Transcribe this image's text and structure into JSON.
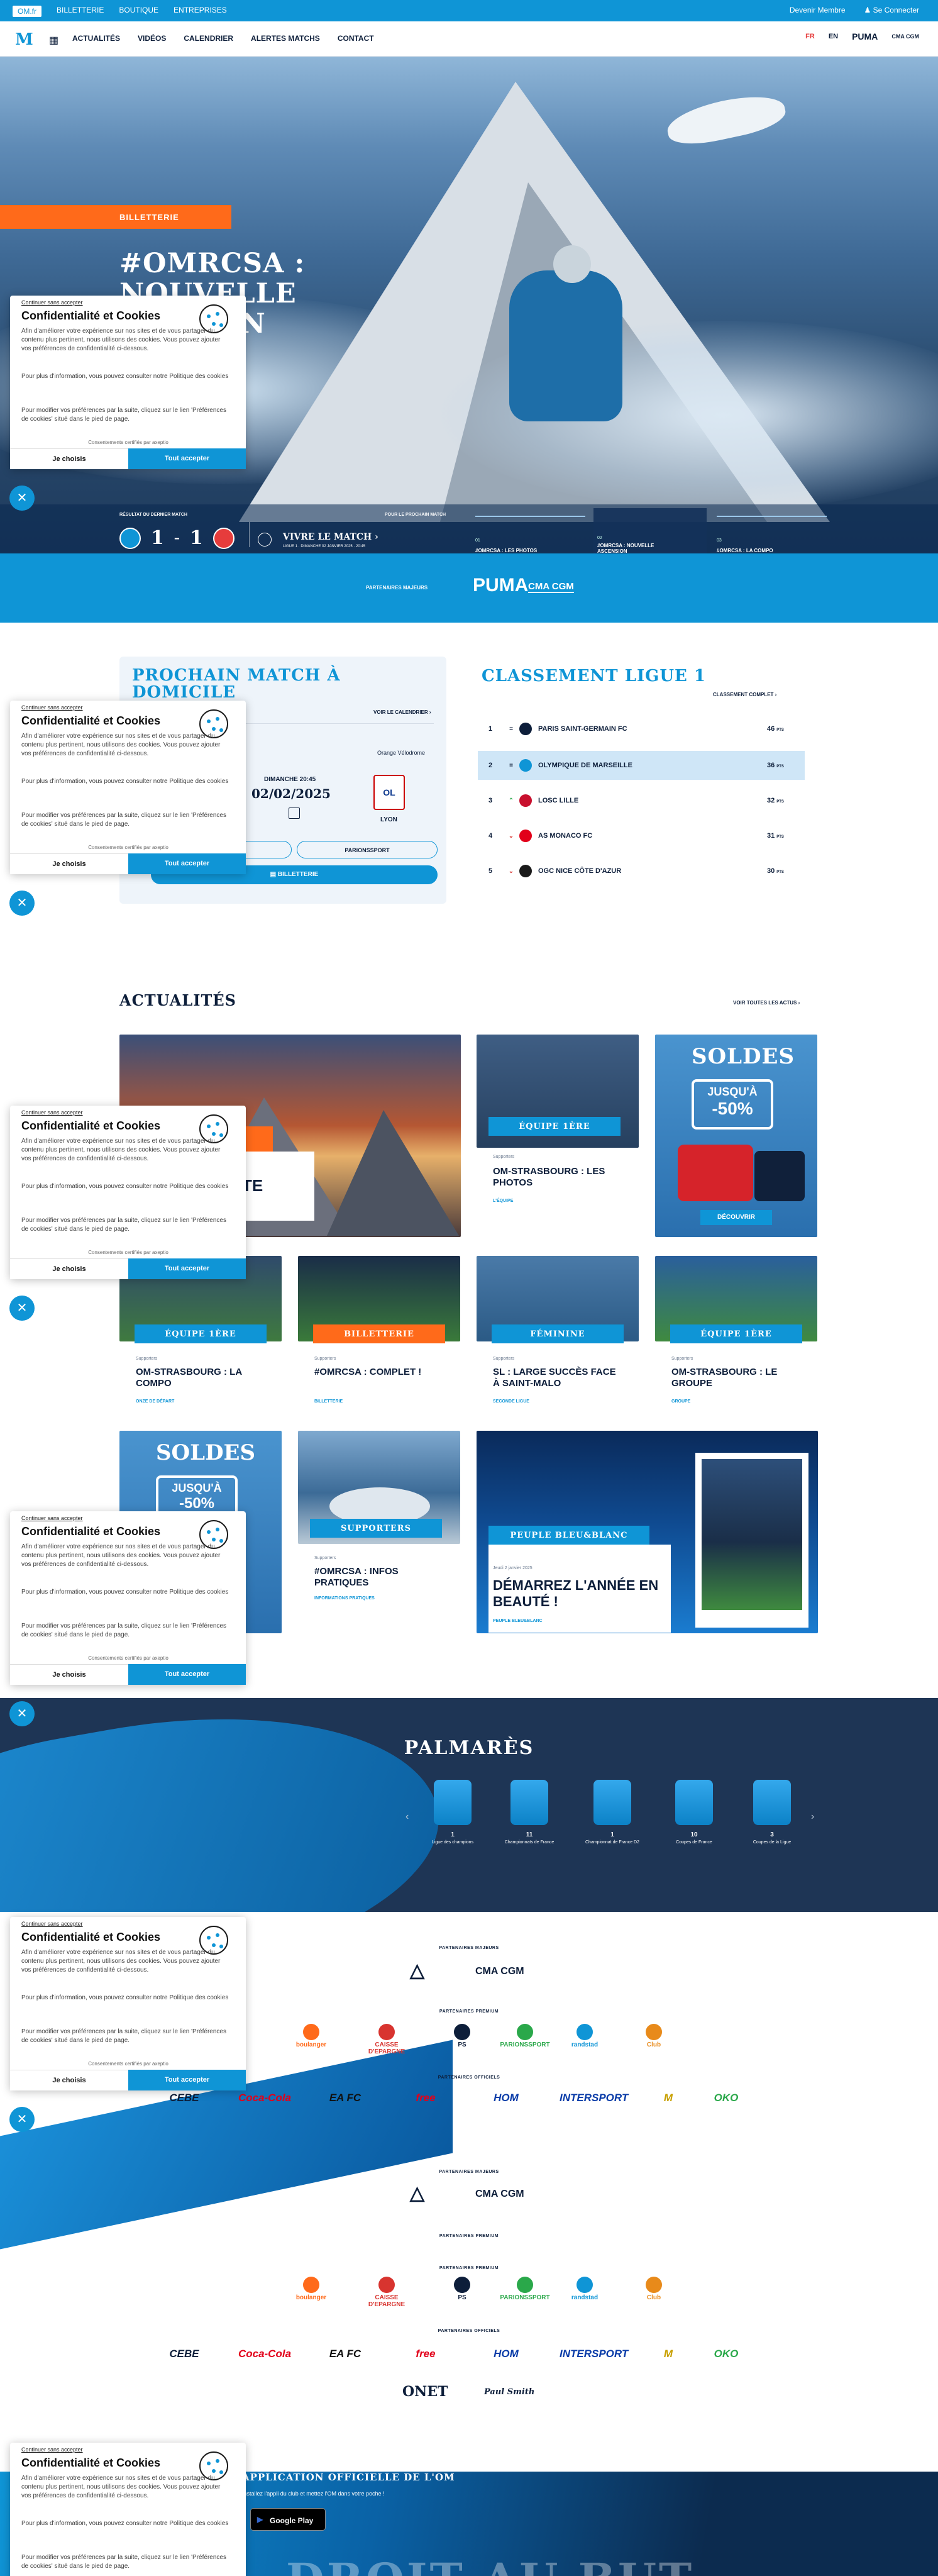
{
  "topbar": {
    "items": [
      "OM.fr",
      "BILLETTERIE",
      "BOUTIQUE",
      "ENTREPRISES"
    ],
    "right": [
      "Devenir Membre",
      "Se Connecter"
    ]
  },
  "nav": {
    "items": [
      "ACTUALITÉS",
      "VIDÉOS",
      "CALENDRIER",
      "ALERTES MATCHS",
      "CONTACT"
    ],
    "langs": [
      "FR",
      "EN"
    ],
    "partner1": "PUMA",
    "partner2": "CMA CGM"
  },
  "hero": {
    "tag": "BILLETTERIE",
    "title": "#OMRCSA : NOUVELLE MISSION",
    "result_label": "RÉSULTAT DU DERNIER MATCH",
    "next_label": "POUR LE PROCHAIN MATCH",
    "score_home": "1",
    "score_sep": "–",
    "score_away": "1",
    "next_title": "VIVRE LE MATCH",
    "next_sub": "LIGUE 1 · DIMANCHE 02 JANVIER 2025 · 20:45",
    "cards": [
      {
        "n": "01",
        "t": "#OMRCSA : LES PHOTOS"
      },
      {
        "n": "02",
        "t": "#OMRCSA : NOUVELLE ASCENSION"
      },
      {
        "n": "03",
        "t": "#OMRCSA : LA COMPO"
      }
    ]
  },
  "partners_band": {
    "label": "PARTENAIRES MAJEURS",
    "p1": "PUMA",
    "p2": "CMA CGM"
  },
  "match": {
    "title1": "PROCHAIN MATCH À",
    "title2": "DOMICILE",
    "calendar": "VOIR LE CALENDRIER",
    "venue": "Orange Vélodrome",
    "date": "DIMANCHE 20:45",
    "day": "02/02/2025",
    "away": "LYON",
    "btn1": "",
    "btn2": "PARIONSSPORT",
    "btn3": "BILLETTERIE"
  },
  "standings": {
    "title": "CLASSEMENT LIGUE 1",
    "full": "CLASSEMENT COMPLET",
    "rows": [
      {
        "pos": "1",
        "ev": "=",
        "name": "PARIS SAINT-GERMAIN FC",
        "pts": "46",
        "c": "#0d1e3a"
      },
      {
        "pos": "2",
        "ev": "=",
        "name": "OLYMPIQUE DE MARSEILLE",
        "pts": "36",
        "c": "#0f95d6"
      },
      {
        "pos": "3",
        "ev": "^",
        "name": "LOSC LILLE",
        "pts": "32",
        "c": "#c8102e"
      },
      {
        "pos": "4",
        "ev": "v",
        "name": "AS MONACO FC",
        "pts": "31",
        "c": "#e2001a"
      },
      {
        "pos": "5",
        "ev": "v",
        "name": "OGC NICE CÔTE D'AZUR",
        "pts": "30",
        "c": "#1a1a1a"
      }
    ],
    "pts_unit": "PTS"
  },
  "news": {
    "title": "ACTUALITÉS",
    "all": "VOIR TOUTES LES ACTUS",
    "big_label": "TE",
    "cards": [
      {
        "tag": "ÉQUIPE 1ÈRE",
        "meta": "Supporters",
        "title": "OM-STRASBOURG : LES PHOTOS",
        "link": "L'ÉQUIPE"
      },
      {
        "tag": "DÉCOUVRIR",
        "title": "SOLDES JUSQU'À -50%"
      },
      {
        "tag": "ÉQUIPE 1ÈRE",
        "meta": "Supporters",
        "title": "OM-STRASBOURG : LA COMPO",
        "link": "ONZE DE DÉPART"
      },
      {
        "tag": "BILLETTERIE",
        "meta": "Supporters",
        "title": "#OMRCSA : COMPLET !",
        "link": "BILLETTERIE"
      },
      {
        "tag": "FÉMININE",
        "meta": "Supporters",
        "title": "SL : LARGE SUCCÈS FACE À SAINT-MALO",
        "link": "SECONDE LIGUE"
      },
      {
        "tag": "ÉQUIPE 1ÈRE",
        "meta": "Supporters",
        "title": "OM-STRASBOURG : LE GROUPE",
        "link": "GROUPE"
      },
      {
        "tag": "SUPPORTERS",
        "meta": "Supporters",
        "title": "#OMRCSA : INFOS PRATIQUES",
        "link": "INFORMATIONS PRATIQUES"
      },
      {
        "tag": "PEUPLE BLEU&BLANC",
        "meta": "Jeudi 2 janvier 2025",
        "title": "DÉMARREZ L'ANNÉE EN BEAUTÉ !",
        "link": "PEUPLE BLEU&BLANC"
      }
    ],
    "soldes1": "SOLDES",
    "soldes2": "JUSQU'À",
    "soldes3": "-50%"
  },
  "palmares": {
    "title": "PALMARÈS",
    "items": [
      {
        "n": "1",
        "l": "Ligue des champions"
      },
      {
        "n": "11",
        "l": "Championnats de France"
      },
      {
        "n": "1",
        "l": "Championnat de France D2"
      },
      {
        "n": "10",
        "l": "Coupes de France"
      },
      {
        "n": "3",
        "l": "Coupes de la Ligue"
      }
    ]
  },
  "partners": {
    "major": "PARTENAIRES MAJEURS",
    "premium": "PARTENAIRES PREMIUM",
    "official": "PARTENAIRES OFFICIELS",
    "premium_list": [
      "boulanger",
      "CAISSE D'EPARGNE",
      "PS",
      "PARIONSSPORT",
      "randstad",
      "Club"
    ],
    "official_list": [
      "CEBE",
      "Coca-Cola",
      "EA FC",
      "free",
      "HOM",
      "INTERSPORT",
      "M",
      "OKO"
    ],
    "extra": [
      "ONET",
      "Paul Smith"
    ]
  },
  "cookie": {
    "cont": "Continuer sans accepter",
    "title": "Confidentialité et Cookies",
    "p1": "Afin d'améliorer votre expérience sur nos sites et de vous partager du contenu plus pertinent, nous utilisons des cookies. Vous pouvez ajouter vos préférences de confidentialité ci-dessous.",
    "p2": "Pour plus d'information, vous pouvez consulter notre Politique des cookies",
    "p3": "Pour modifier vos préférences par la suite, cliquez sur le lien 'Préférences de cookies' situé dans le pied de page.",
    "cert": "Consentements certifiés par axeptio",
    "b1": "Je choisis",
    "b2": "Tout accepter"
  },
  "app": {
    "title": "APPLICATION OFFICIELLE DE L'OM",
    "sub": "Installez l'appli du club et mettez l'OM dans votre poche !",
    "store": "Google Play",
    "big": "DROIT AU BUT"
  }
}
